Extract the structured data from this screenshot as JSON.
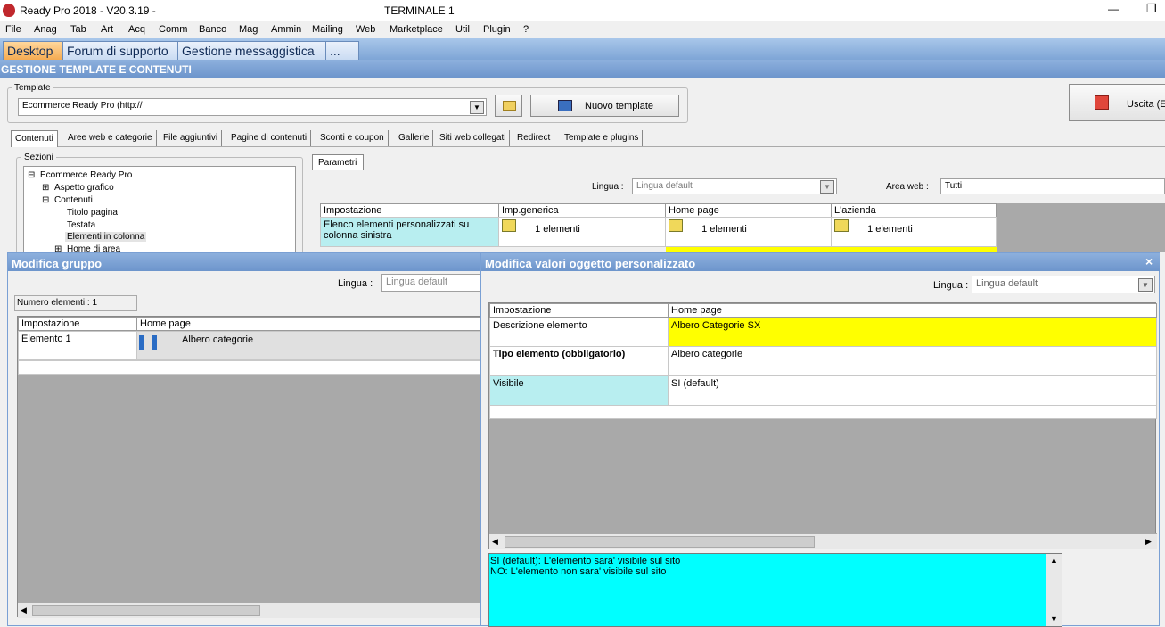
{
  "window": {
    "app_title": "Ready Pro 2018 - V20.3.19 -",
    "terminal": "TERMINALE 1",
    "minimize": "—",
    "restore": "❐"
  },
  "menu": [
    "File",
    "Anag",
    "Tab",
    "Art",
    "Acq",
    "Comm",
    "Banco",
    "Mag",
    "Ammin",
    "Mailing",
    "Web",
    "Marketplace",
    "Util",
    "Plugin",
    "?"
  ],
  "doc_tabs": [
    "Desktop",
    "Forum di supporto",
    "Gestione messaggistica",
    "..."
  ],
  "section_title": "GESTIONE TEMPLATE E CONTENUTI",
  "template": {
    "group_label": "Template",
    "value": "Ecommerce Ready Pro (http://",
    "new_button": "Nuovo template",
    "exit_button": "Uscita (E"
  },
  "sub_tabs": [
    "Contenuti",
    "Aree web e categorie",
    "File aggiuntivi",
    "Pagine di contenuti",
    "Sconti e coupon",
    "Gallerie",
    "Siti web collegati",
    "Redirect",
    "Template e plugins"
  ],
  "sections": {
    "label": "Sezioni",
    "items": [
      {
        "label": "Ecommerce Ready Pro",
        "toggle": "⊟"
      },
      {
        "label": "Aspetto grafico",
        "toggle": "⊞"
      },
      {
        "label": "Contenuti",
        "toggle": "⊟"
      },
      {
        "label": "Titolo pagina",
        "toggle": ""
      },
      {
        "label": "Testata",
        "toggle": ""
      },
      {
        "label": "Elementi in colonna",
        "toggle": ""
      },
      {
        "label": "Home di area",
        "toggle": "⊞"
      }
    ]
  },
  "params": {
    "tab": "Parametri",
    "lingua_label": "Lingua :",
    "lingua_value": "Lingua default",
    "area_label": "Area web :",
    "area_value": "Tutti",
    "headers": [
      "Impostazione",
      "Imp.generica",
      "Home page",
      "L'azienda"
    ],
    "row": {
      "setting": "Elenco elementi personalizzati su colonna sinistra",
      "values": [
        "1 elementi",
        "1 elementi",
        "1 elementi"
      ]
    }
  },
  "group_panel": {
    "title": "Modifica gruppo",
    "lingua_label": "Lingua :",
    "lingua_placeholder": "Lingua default",
    "count": "Numero elementi : 1",
    "headers": [
      "Impostazione",
      "Home page"
    ],
    "row": {
      "setting": "Elemento 1",
      "value": "Albero categorie"
    }
  },
  "custom_panel": {
    "title": "Modifica valori oggetto personalizzato",
    "close": "×",
    "lingua_label": "Lingua :",
    "lingua_value": "Lingua default",
    "headers": [
      "Impostazione",
      "Home page"
    ],
    "rows": [
      {
        "setting": "Descrizione elemento",
        "value": "Albero Categorie SX"
      },
      {
        "setting": "Tipo elemento (obbligatorio)",
        "value": "Albero categorie"
      },
      {
        "setting": "Visibile",
        "value": "SI (default)"
      }
    ],
    "help": [
      "SI (default): L'elemento sara' visibile sul sito",
      "NO: L'elemento non sara' visibile sul sito"
    ]
  },
  "colors": {
    "cyan": "#00ffff",
    "light_cyan": "#b8eef0",
    "yellow": "#ffff00",
    "title_blue": "#7aa0d4"
  }
}
